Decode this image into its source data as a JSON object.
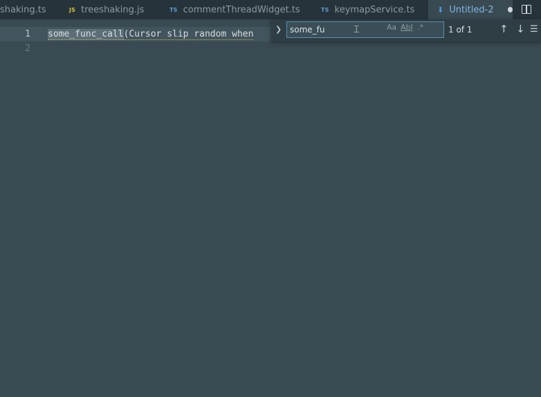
{
  "tabs": [
    {
      "badge": "",
      "label": "shaking.ts"
    },
    {
      "badge": "JS",
      "label": "treeshaking.js"
    },
    {
      "badge": "TS",
      "label": "commentThreadWidget.ts"
    },
    {
      "badge": "TS",
      "label": "keymapService.ts"
    },
    {
      "badge": "",
      "label": "Untitled-2"
    }
  ],
  "editor": {
    "lines": [
      "1",
      "2"
    ],
    "code": {
      "match": "some_func_call",
      "rest": "(Cursor slip random when"
    }
  },
  "find": {
    "query": "some_fu",
    "match_case_label": "Aa",
    "whole_word_label": "AbI",
    "regex_label": ".*",
    "count": "1 of 1",
    "prev_icon": "↑",
    "next_icon": "↓"
  }
}
